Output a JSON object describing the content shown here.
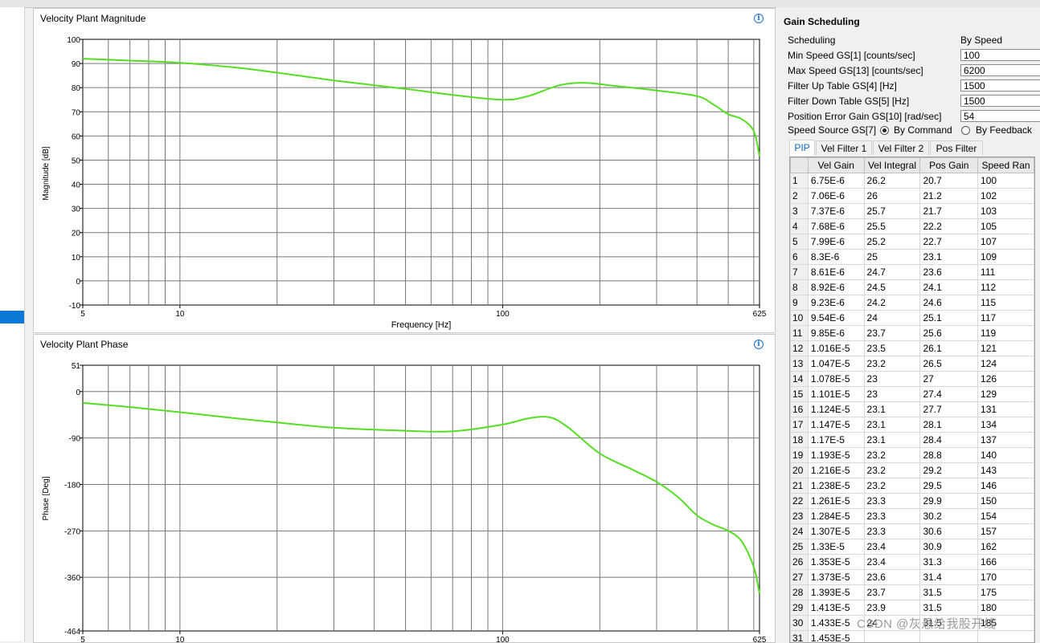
{
  "magnitude_panel": {
    "title": "Velocity Plant Magnitude",
    "y_axis_label": "Magnitude [dB]",
    "x_axis_label": "Frequency [Hz]",
    "info_icon": "info-icon"
  },
  "phase_panel": {
    "title": "Velocity Plant Phase",
    "y_axis_label": "Phase [Deg]",
    "info_icon": "info-icon"
  },
  "chart_data": [
    {
      "type": "line",
      "title": "Velocity Plant Magnitude",
      "xlabel": "Frequency [Hz]",
      "ylabel": "Magnitude [dB]",
      "xscale": "log",
      "xlim": [
        5,
        625
      ],
      "ylim": [
        -10,
        100
      ],
      "x_ticks": [
        "5",
        "10",
        "100",
        "625"
      ],
      "y_ticks": [
        "-10",
        "0",
        "10",
        "20",
        "30",
        "40",
        "50",
        "60",
        "70",
        "80",
        "90",
        "100"
      ],
      "grid": true,
      "line_color": "#55dd22",
      "x": [
        5,
        7,
        10,
        15,
        20,
        30,
        50,
        70,
        100,
        120,
        150,
        180,
        220,
        300,
        400,
        450,
        500,
        550,
        600,
        625
      ],
      "y": [
        92,
        91.2,
        90.3,
        88.3,
        86.2,
        83,
        79.5,
        77,
        75,
        76.5,
        81,
        82,
        80.8,
        78.8,
        76.5,
        73,
        69,
        67,
        62,
        51.5
      ]
    },
    {
      "type": "line",
      "title": "Velocity Plant Phase",
      "xlabel": "",
      "ylabel": "Phase [Deg]",
      "xscale": "log",
      "xlim": [
        5,
        625
      ],
      "ylim": [
        -464,
        51
      ],
      "x_ticks": [
        "5",
        "10",
        "100",
        "625"
      ],
      "y_ticks": [
        "51",
        "0",
        "-90",
        "-180",
        "-270",
        "-360",
        "-464"
      ],
      "grid": true,
      "line_color": "#55dd22",
      "x": [
        5,
        7,
        10,
        15,
        20,
        30,
        50,
        70,
        100,
        120,
        140,
        160,
        200,
        250,
        300,
        350,
        400,
        450,
        500,
        550,
        600,
        625
      ],
      "y": [
        -22,
        -30,
        -40,
        -52,
        -60,
        -70,
        -76,
        -77,
        -64,
        -52,
        -50,
        -70,
        -120,
        -150,
        -175,
        -205,
        -240,
        -258,
        -270,
        -290,
        -340,
        -392
      ]
    }
  ],
  "gain_scheduling": {
    "title": "Gain Scheduling",
    "scheduling_label": "Scheduling",
    "scheduling_value": "By Speed",
    "fields": [
      {
        "label": "Min Speed GS[1] [counts/sec]",
        "value": "100"
      },
      {
        "label": "Max Speed GS[13] [counts/sec]",
        "value": "6200"
      },
      {
        "label": "Filter Up Table GS[4] [Hz]",
        "value": "1500"
      },
      {
        "label": "Filter Down Table GS[5] [Hz]",
        "value": "1500"
      },
      {
        "label": "Position Error Gain GS[10] [rad/sec]",
        "value": "54"
      }
    ],
    "speed_source_label": "Speed Source GS[7]",
    "speed_source_options": [
      "By Command",
      "By Feedback"
    ],
    "speed_source_selected": "By Command",
    "tabs": [
      "PIP",
      "Vel Filter 1",
      "Vel Filter 2",
      "Pos Filter"
    ],
    "active_tab": "PIP",
    "columns": [
      "Vel Gain",
      "Vel Integral",
      "Pos Gain",
      "Speed Ran"
    ],
    "rows": [
      [
        "1",
        "6.75E-6",
        "26.2",
        "20.7",
        "100"
      ],
      [
        "2",
        "7.06E-6",
        "26",
        "21.2",
        "102"
      ],
      [
        "3",
        "7.37E-6",
        "25.7",
        "21.7",
        "103"
      ],
      [
        "4",
        "7.68E-6",
        "25.5",
        "22.2",
        "105"
      ],
      [
        "5",
        "7.99E-6",
        "25.2",
        "22.7",
        "107"
      ],
      [
        "6",
        "8.3E-6",
        "25",
        "23.1",
        "109"
      ],
      [
        "7",
        "8.61E-6",
        "24.7",
        "23.6",
        "111"
      ],
      [
        "8",
        "8.92E-6",
        "24.5",
        "24.1",
        "112"
      ],
      [
        "9",
        "9.23E-6",
        "24.2",
        "24.6",
        "115"
      ],
      [
        "10",
        "9.54E-6",
        "24",
        "25.1",
        "117"
      ],
      [
        "11",
        "9.85E-6",
        "23.7",
        "25.6",
        "119"
      ],
      [
        "12",
        "1.016E-5",
        "23.5",
        "26.1",
        "121"
      ],
      [
        "13",
        "1.047E-5",
        "23.2",
        "26.5",
        "124"
      ],
      [
        "14",
        "1.078E-5",
        "23",
        "27",
        "126"
      ],
      [
        "15",
        "1.101E-5",
        "23",
        "27.4",
        "129"
      ],
      [
        "16",
        "1.124E-5",
        "23.1",
        "27.7",
        "131"
      ],
      [
        "17",
        "1.147E-5",
        "23.1",
        "28.1",
        "134"
      ],
      [
        "18",
        "1.17E-5",
        "23.1",
        "28.4",
        "137"
      ],
      [
        "19",
        "1.193E-5",
        "23.2",
        "28.8",
        "140"
      ],
      [
        "20",
        "1.216E-5",
        "23.2",
        "29.2",
        "143"
      ],
      [
        "21",
        "1.238E-5",
        "23.2",
        "29.5",
        "146"
      ],
      [
        "22",
        "1.261E-5",
        "23.3",
        "29.9",
        "150"
      ],
      [
        "23",
        "1.284E-5",
        "23.3",
        "30.2",
        "154"
      ],
      [
        "24",
        "1.307E-5",
        "23.3",
        "30.6",
        "157"
      ],
      [
        "25",
        "1.33E-5",
        "23.4",
        "30.9",
        "162"
      ],
      [
        "26",
        "1.353E-5",
        "23.4",
        "31.3",
        "166"
      ],
      [
        "27",
        "1.373E-5",
        "23.6",
        "31.4",
        "170"
      ],
      [
        "28",
        "1.393E-5",
        "23.7",
        "31.5",
        "175"
      ],
      [
        "29",
        "1.413E-5",
        "23.9",
        "31.5",
        "180"
      ],
      [
        "30",
        "1.433E-5",
        "24",
        "31.5",
        "185"
      ],
      [
        "31",
        "1.453E-5",
        "",
        "",
        ""
      ]
    ]
  },
  "watermark": "CSDN @灰悬给我股开线"
}
